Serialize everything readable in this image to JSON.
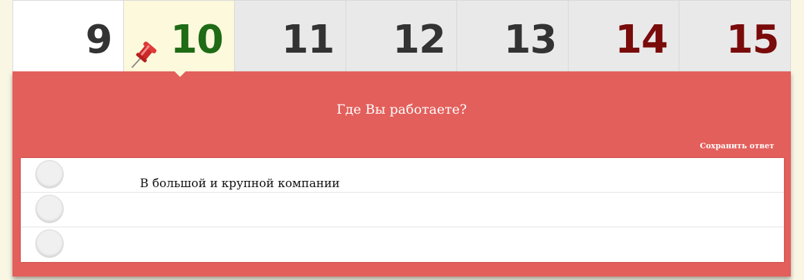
{
  "calendar": {
    "days": [
      {
        "label": "9",
        "style": "past"
      },
      {
        "label": "10",
        "style": "today"
      },
      {
        "label": "11",
        "style": "weekday"
      },
      {
        "label": "12",
        "style": "weekday"
      },
      {
        "label": "13",
        "style": "weekday"
      },
      {
        "label": "14",
        "style": "weekend"
      },
      {
        "label": "15",
        "style": "weekend"
      }
    ],
    "colors": {
      "default_number": "#333333",
      "today_number": "#1f6b16",
      "weekend_number": "#7a0b0b",
      "today_background": "#fcf9dc",
      "weekday_background": "#e9e9e9"
    },
    "today_marker_icon": "pushpin-icon"
  },
  "poll": {
    "question": "Где Вы работаете?",
    "save_label": "Сохранить ответ",
    "panel_color": "#e35f5b",
    "options": [
      {
        "label": "В большой и крупной компании",
        "selected": false
      },
      {
        "label": "",
        "selected": false
      },
      {
        "label": "",
        "selected": false
      }
    ]
  }
}
